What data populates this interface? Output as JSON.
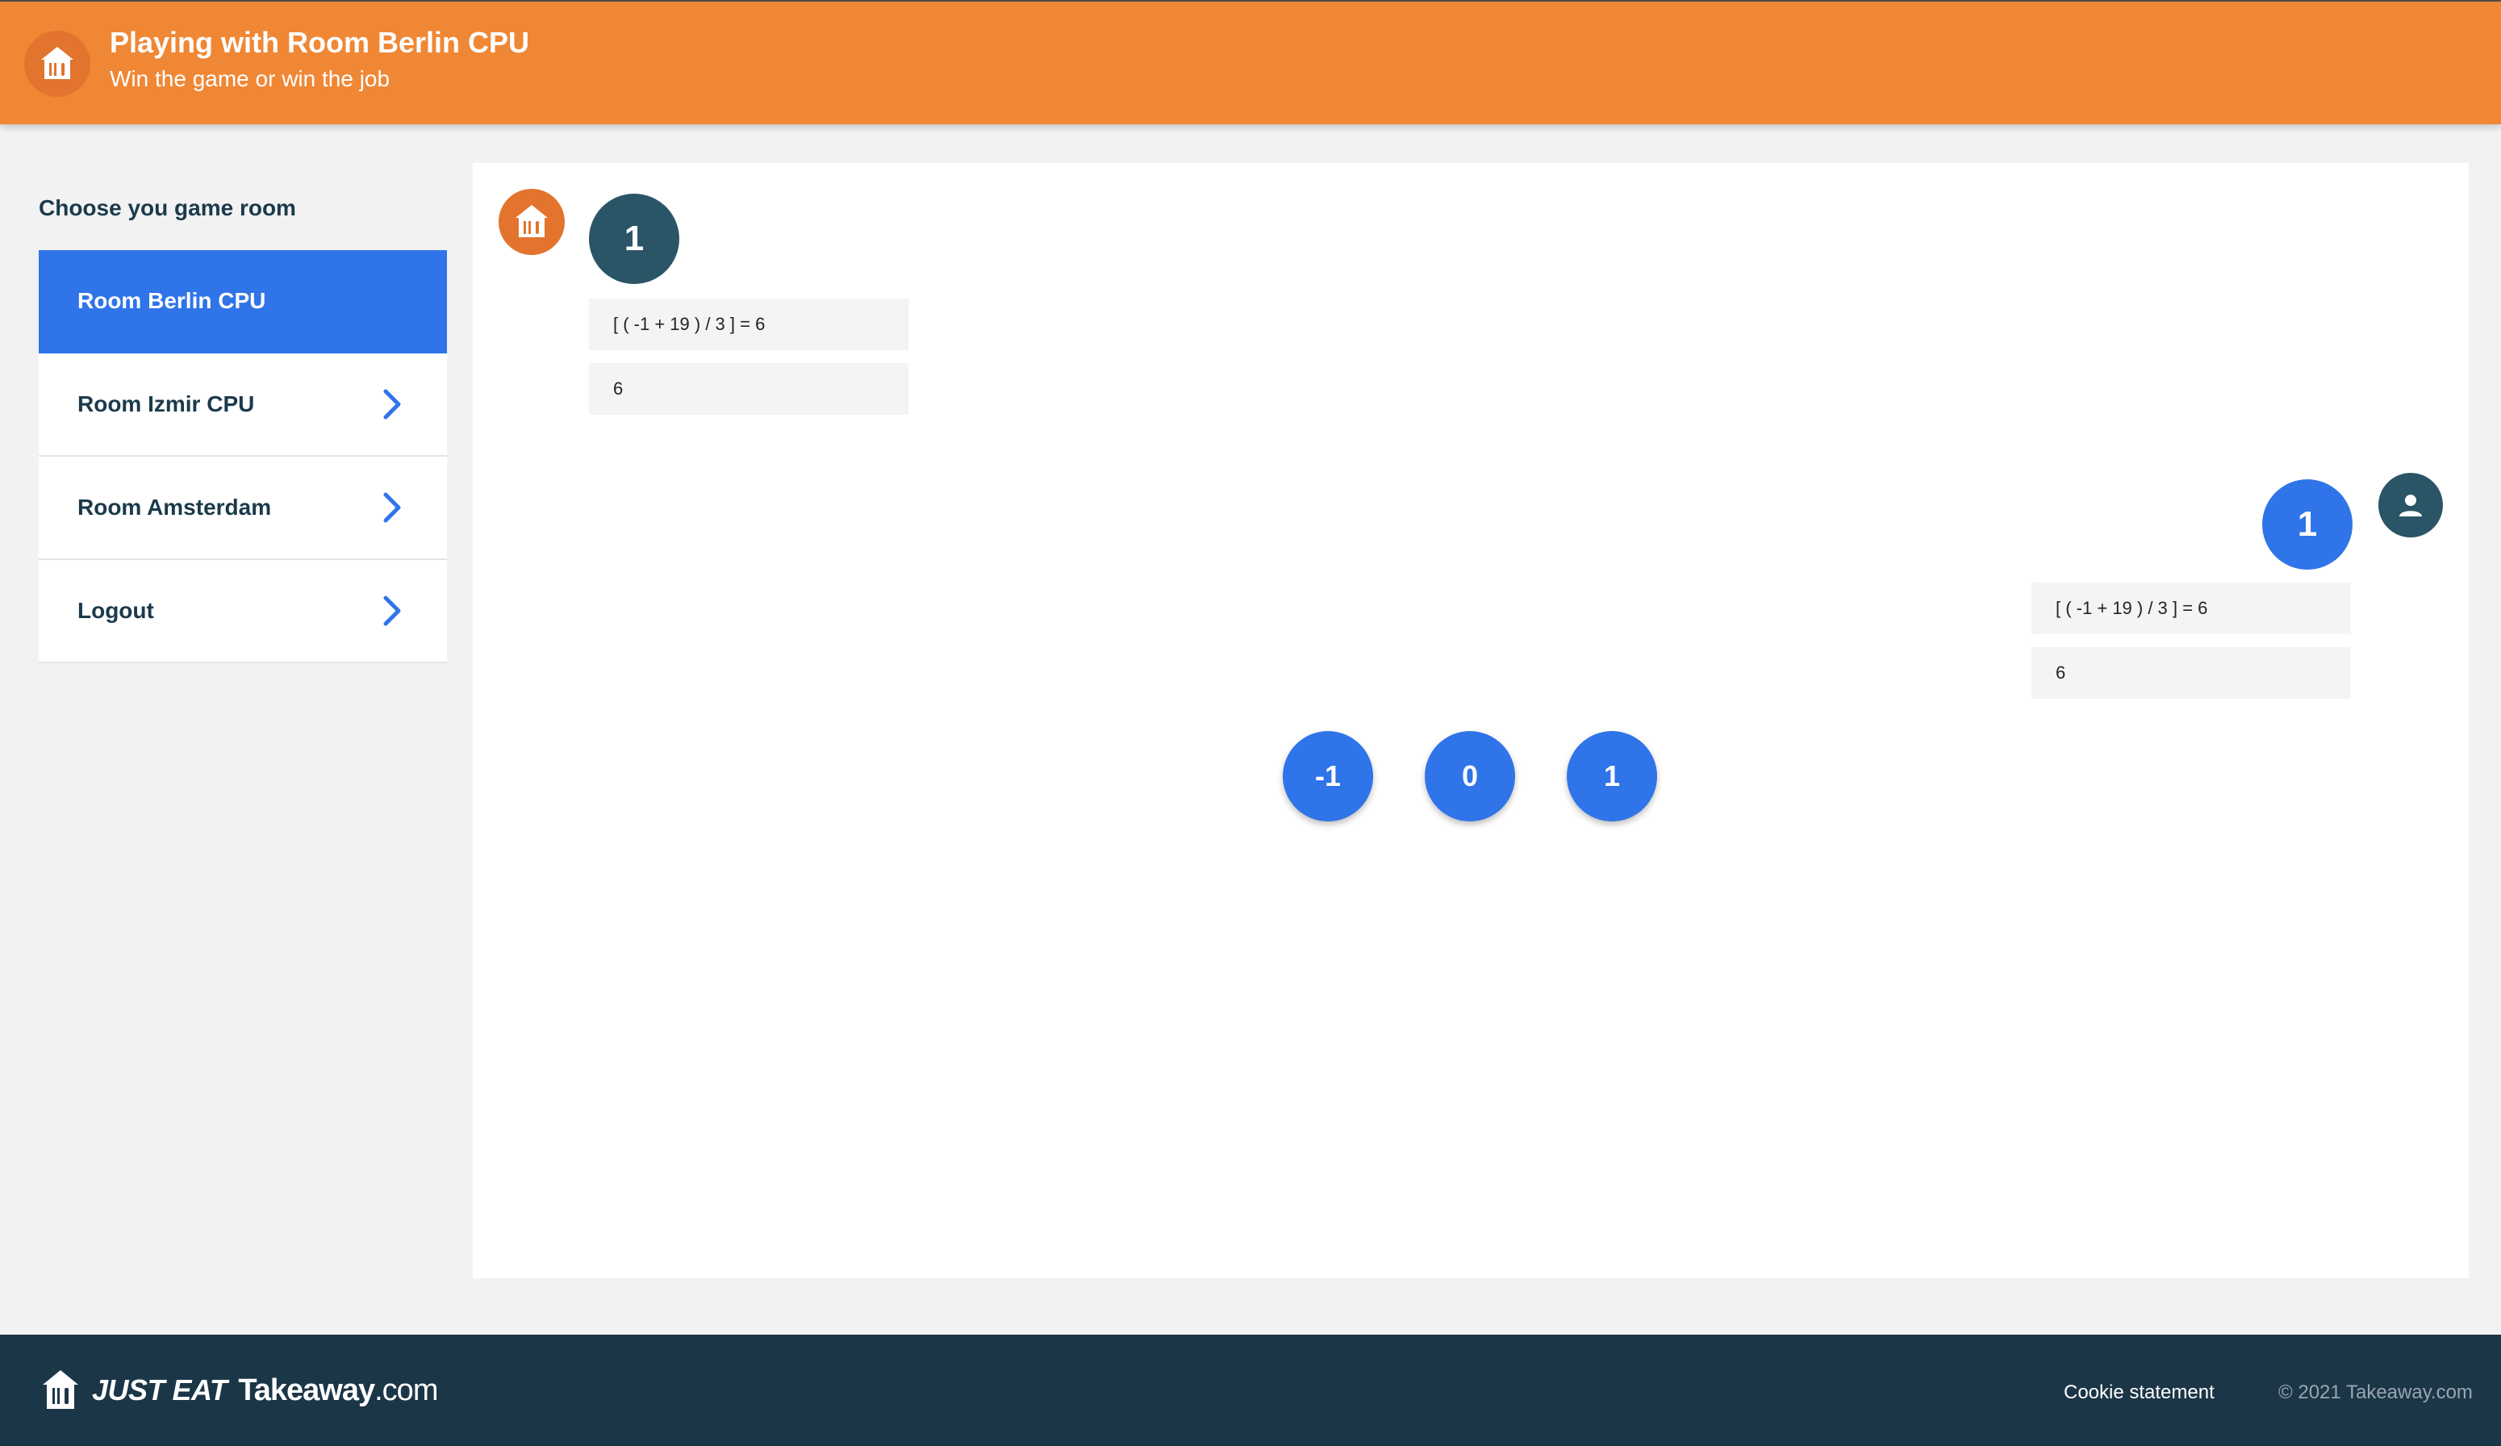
{
  "colors": {
    "header_bg": "#f08735",
    "accent_blue": "#2f74e9",
    "dark_teal": "#2a5566",
    "footer_bg": "#1b3647"
  },
  "header": {
    "title": "Playing with Room Berlin CPU",
    "subtitle": "Win the game or win the job",
    "logo_icon": "takeaway-house-icon"
  },
  "sidebar": {
    "heading": "Choose you game room",
    "items": [
      {
        "label": "Room Berlin CPU",
        "active": true
      },
      {
        "label": "Room Izmir CPU",
        "icon": "chevron-right-icon"
      },
      {
        "label": "Room Amsterdam",
        "icon": "chevron-right-icon"
      },
      {
        "label": "Logout",
        "icon": "chevron-right-icon"
      }
    ]
  },
  "game": {
    "cpu_move": {
      "number": "1",
      "equation": "[ ( -1 + 19 ) / 3 ] = 6",
      "result": "6"
    },
    "player_move": {
      "number": "1",
      "equation": "[ ( -1 + 19 ) / 3 ] = 6",
      "result": "6",
      "avatar_icon": "user-icon"
    },
    "choices": [
      "-1",
      "0",
      "1"
    ]
  },
  "footer": {
    "brand_just_eat": "JUST EAT",
    "brand_takeaway": "Takeaway",
    "brand_com": ".com",
    "cookie_link": "Cookie statement",
    "copyright": "© 2021 Takeaway.com"
  }
}
